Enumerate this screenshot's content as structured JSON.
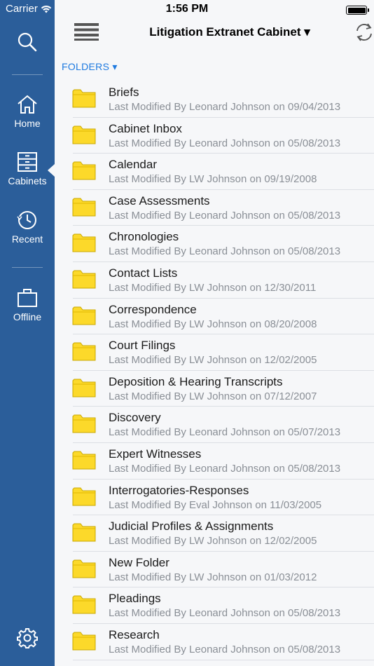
{
  "status_bar": {
    "carrier": "Carrier",
    "time": "1:56 PM"
  },
  "sidebar": {
    "items": [
      {
        "label": "Home",
        "icon": "home-icon"
      },
      {
        "label": "Cabinets",
        "icon": "cabinet-icon",
        "active": true
      },
      {
        "label": "Recent",
        "icon": "clock-icon"
      },
      {
        "label": "Offline",
        "icon": "briefcase-icon"
      }
    ],
    "settings_icon": "gear-icon",
    "search_icon": "search-icon"
  },
  "header": {
    "title": "Litigation Extranet Cabinet ▾",
    "folders_label": "FOLDERS ▾"
  },
  "colors": {
    "sidebar_bg": "#2b5e9a",
    "accent": "#1e7ae0",
    "folder_fill": "#fcd92a"
  },
  "folders": [
    {
      "name": "Briefs",
      "meta": "Last Modified By Leonard Johnson on 09/04/2013"
    },
    {
      "name": "Cabinet Inbox",
      "meta": "Last Modified By Leonard Johnson on 05/08/2013"
    },
    {
      "name": "Calendar",
      "meta": "Last Modified By LW Johnson on 09/19/2008"
    },
    {
      "name": "Case Assessments",
      "meta": "Last Modified By Leonard Johnson on 05/08/2013"
    },
    {
      "name": "Chronologies",
      "meta": "Last Modified By Leonard Johnson on 05/08/2013"
    },
    {
      "name": "Contact Lists",
      "meta": "Last Modified By LW Johnson on 12/30/2011"
    },
    {
      "name": "Correspondence",
      "meta": "Last Modified By LW Johnson on 08/20/2008"
    },
    {
      "name": "Court Filings",
      "meta": "Last Modified By LW Johnson on 12/02/2005"
    },
    {
      "name": "Deposition & Hearing Transcripts",
      "meta": "Last Modified By LW Johnson on 07/12/2007"
    },
    {
      "name": "Discovery",
      "meta": "Last Modified By Leonard Johnson on 05/07/2013"
    },
    {
      "name": "Expert Witnesses",
      "meta": "Last Modified By Leonard Johnson on 05/08/2013"
    },
    {
      "name": "Interrogatories-Responses",
      "meta": "Last Modified By Eval Johnson on 11/03/2005"
    },
    {
      "name": "Judicial Profiles & Assignments",
      "meta": "Last Modified By LW Johnson on 12/02/2005"
    },
    {
      "name": "New Folder",
      "meta": "Last Modified By LW Johnson on 01/03/2012"
    },
    {
      "name": "Pleadings",
      "meta": "Last Modified By Leonard Johnson on 05/08/2013"
    },
    {
      "name": "Research",
      "meta": "Last Modified By Leonard Johnson on 05/08/2013"
    }
  ]
}
